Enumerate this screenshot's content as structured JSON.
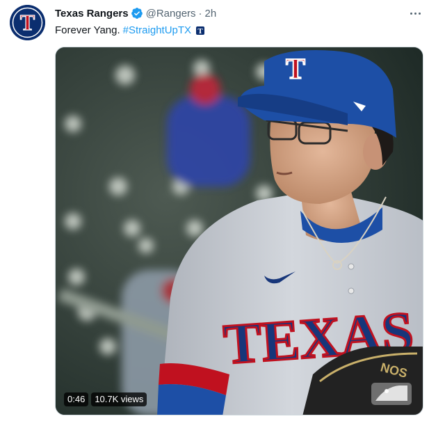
{
  "tweet": {
    "display_name": "Texas Rangers",
    "handle": "@Rangers",
    "separator": "·",
    "time": "2h",
    "text": "Forever Yang.",
    "hashtag": "#StraightUpTX",
    "avatar_letter": "T",
    "avatar_color": "#0b2e6f",
    "avatar_accent": "#c0111f",
    "verified_color": "#1d9bf0",
    "more_icon": "more-horizontal-icon"
  },
  "media": {
    "type": "video",
    "duration": "0:46",
    "views": "10.7K views",
    "jersey_text": "TEXAS",
    "cap_logo_letter": "T",
    "glove_text": "NOS",
    "watermark": "mlb-logo-icon",
    "colors": {
      "cap": "#1d4fa6",
      "jersey": "#c7cbd2",
      "lettering": "#17367a",
      "trim": "#c0111f"
    }
  }
}
